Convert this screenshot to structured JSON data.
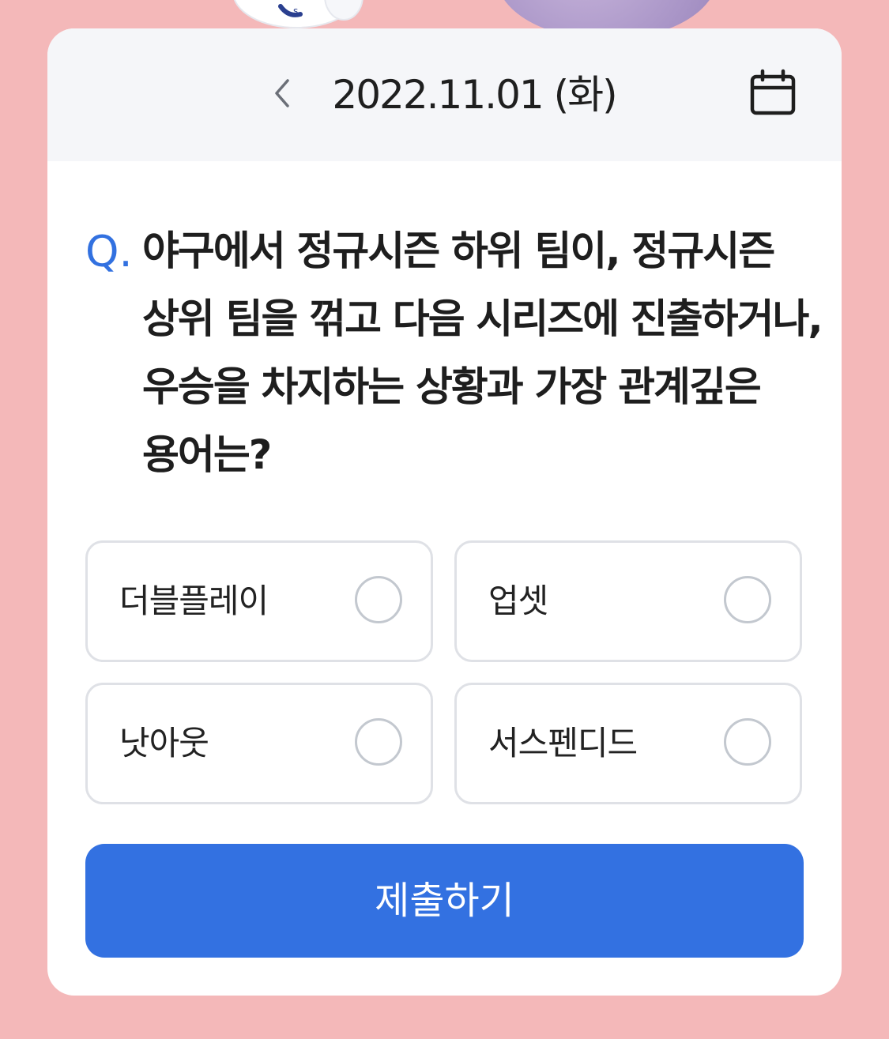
{
  "header": {
    "date": "2022.11.01 (화)",
    "prev_icon": "chevron-left-icon",
    "calendar_icon": "calendar-icon"
  },
  "question": {
    "prefix": "Q.",
    "text": "야구에서 정규시즌 하위 팀이, 정규시즌 상위 팀을 꺾고 다음 시리즈에 진출하거나, 우승을 차지하는 상황과 가장 관계깊은 용어는?"
  },
  "options": [
    {
      "label": "더블플레이",
      "selected": false
    },
    {
      "label": "업셋",
      "selected": false
    },
    {
      "label": "낫아웃",
      "selected": false
    },
    {
      "label": "서스펜디드",
      "selected": false
    }
  ],
  "submit": {
    "label": "제출하기"
  },
  "colors": {
    "background": "#f4b8b9",
    "accent": "#3371e1",
    "header_bg": "#f5f6f9"
  }
}
